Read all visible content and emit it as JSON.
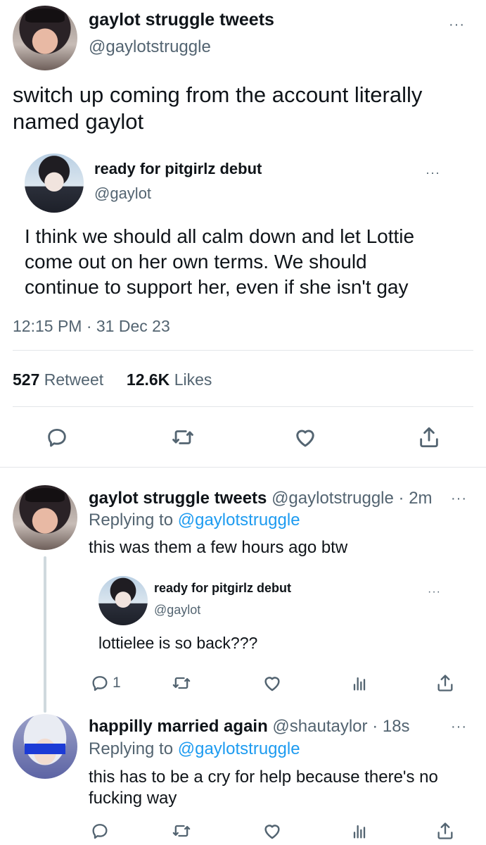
{
  "main_tweet": {
    "author_name": "gaylot struggle tweets",
    "author_handle": "@gaylotstruggle",
    "text_line1": "switch up coming from the account literally",
    "text_line2": "named gaylot",
    "quoted": {
      "author_name": "ready for pitgirlz debut",
      "author_handle": "@gaylot",
      "text_line1": "I think we should all calm down and let Lottie",
      "text_line2": "come out on her own terms. We should",
      "text_line3": "continue to support her, even if she isn't gay"
    },
    "timestamp": "12:15 PM · 31 Dec 23",
    "retweets_count": "527",
    "retweets_label": "Retweet",
    "likes_count": "12.6K",
    "likes_label": "Likes"
  },
  "reply1": {
    "author_name": "gaylot struggle tweets",
    "author_handle": "@gaylotstruggle",
    "time": "· 2m",
    "replying_prefix": "Replying to",
    "replying_to": "@gaylotstruggle",
    "text": "this was them a few hours ago btw",
    "quoted": {
      "author_name": "ready for pitgirlz debut",
      "author_handle": "@gaylot",
      "text": "lottielee is so back???"
    },
    "reply_count": "1"
  },
  "reply2": {
    "author_name": "happilly married again",
    "author_handle": "@shautaylor",
    "time": "· 18s",
    "replying_prefix": "Replying to",
    "replying_to": "@gaylotstruggle",
    "text_line1": "this has to be a cry for help because there's no",
    "text_line2": "fucking way"
  },
  "icons": [
    "more-icon",
    "reply-icon",
    "retweet-icon",
    "like-icon",
    "share-icon",
    "views-icon"
  ],
  "colors": {
    "link": "#1d9bf0",
    "secondary": "#536471",
    "primary": "#0f1419",
    "divider": "#e3e6e9"
  }
}
